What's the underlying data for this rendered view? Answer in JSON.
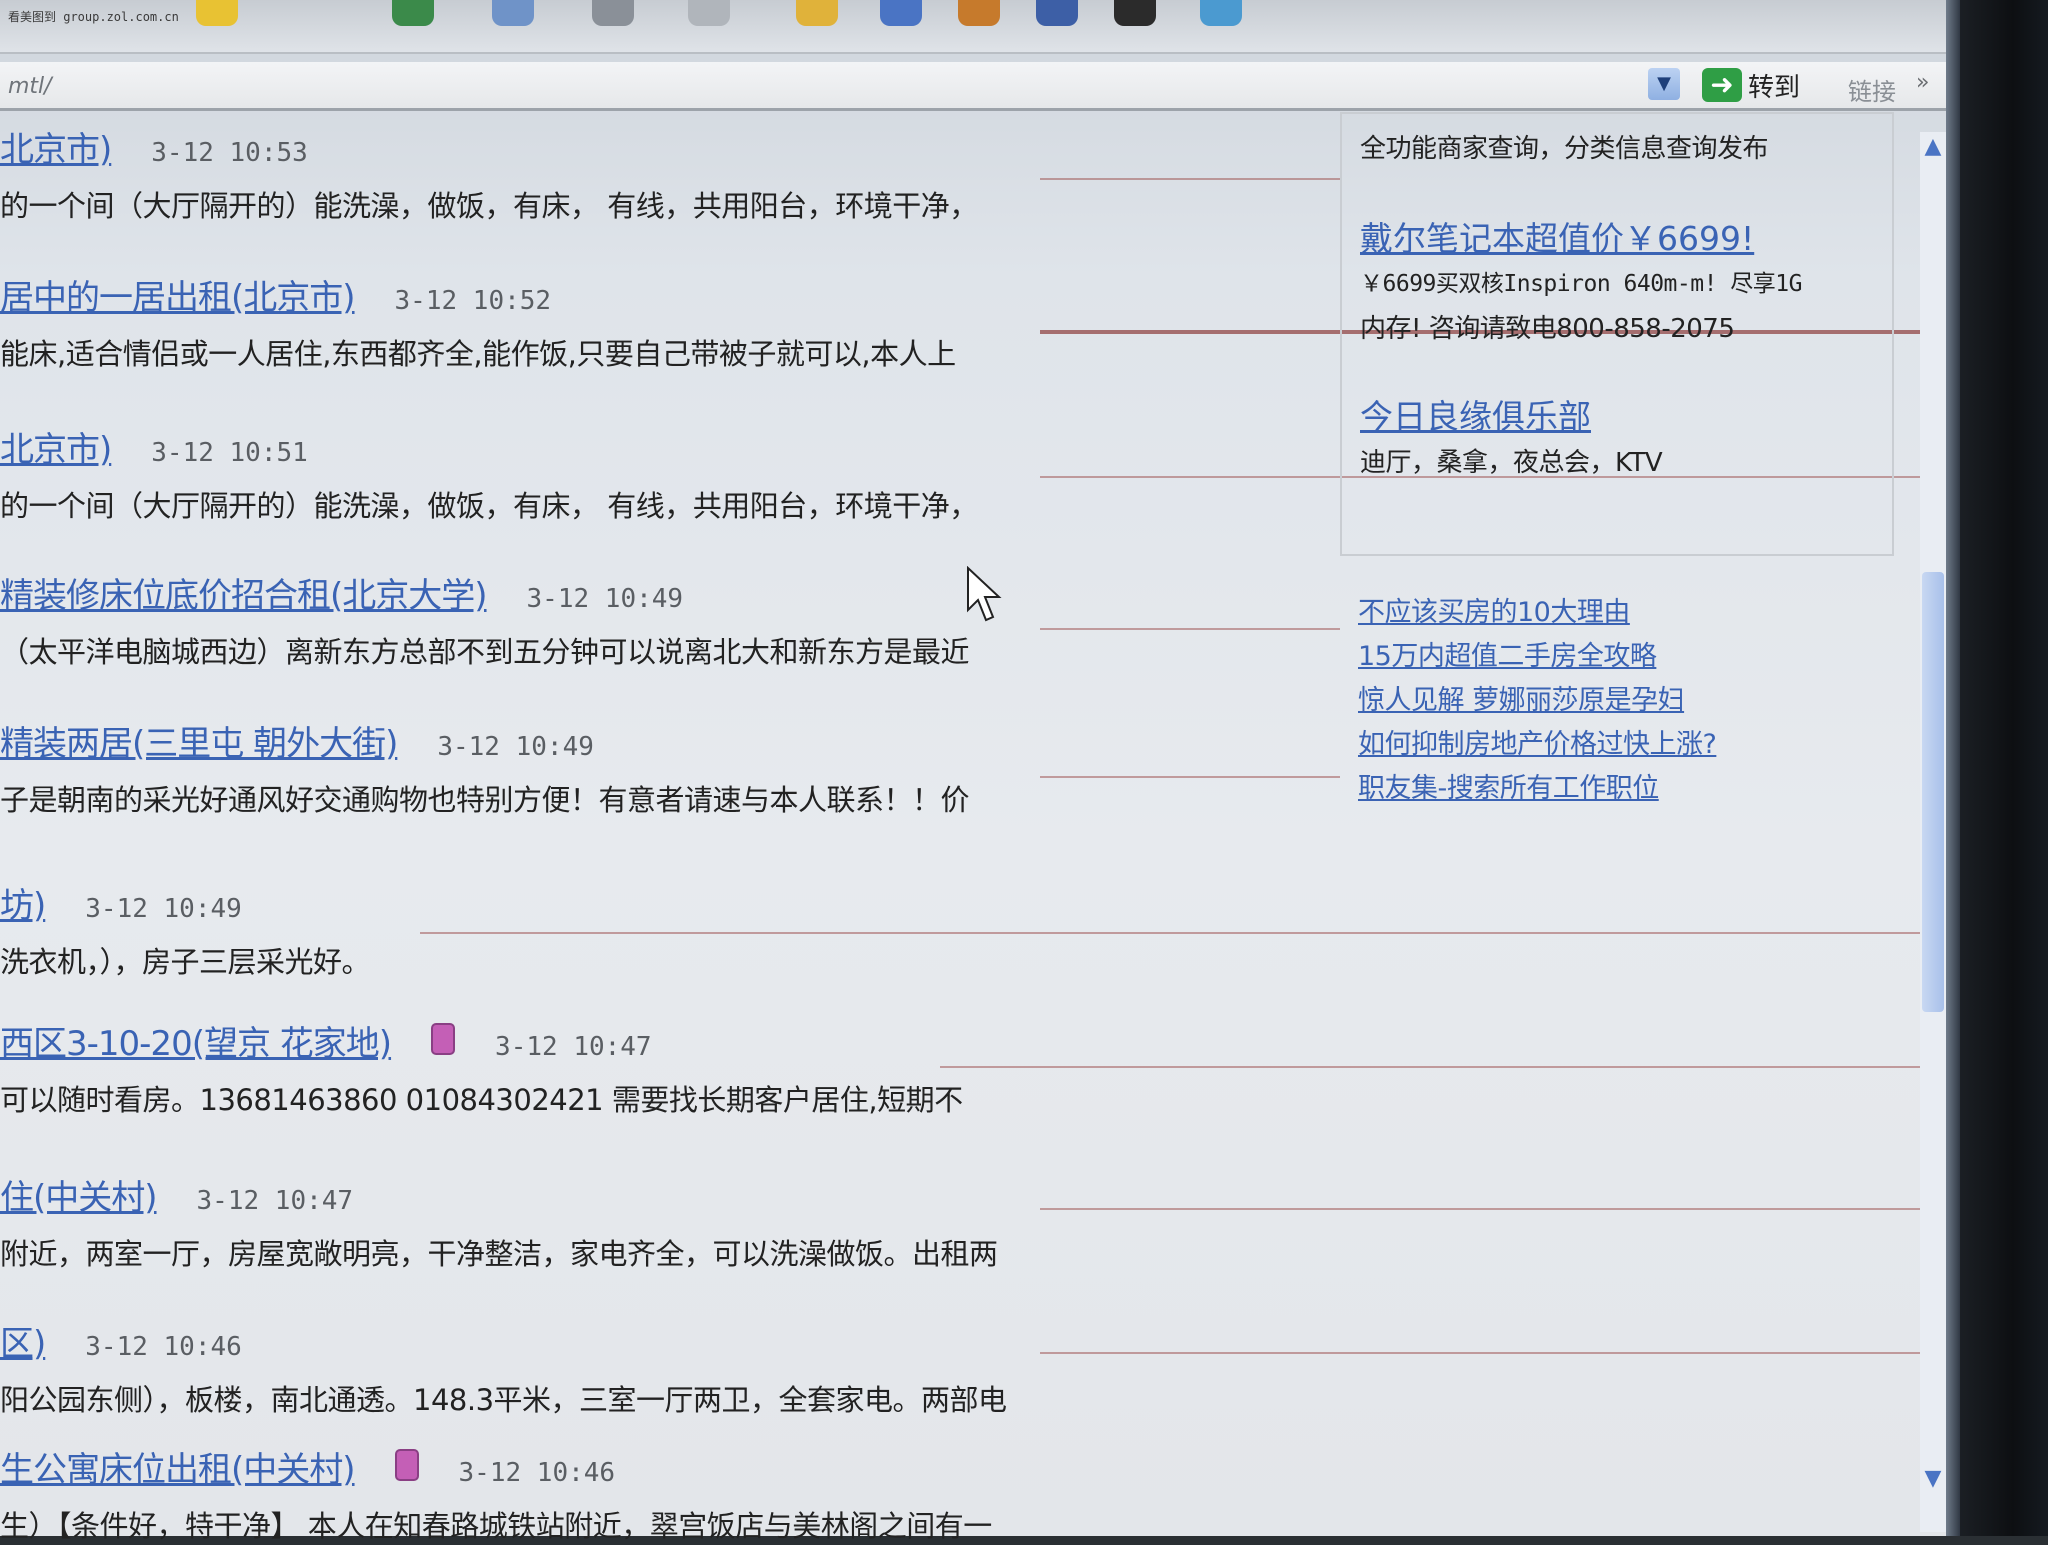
{
  "watermark": "看美图到 group.zol.com.cn",
  "address": {
    "text": "mtl/",
    "go_label": "转到",
    "links_label": "链接",
    "overflow": "»"
  },
  "listings": [
    {
      "title": "北京市)",
      "time": "3-12 10:53",
      "snippet": "的一个间（大厅隔开的）能洗澡，做饭，有床， 有线，共用阳台，环境干净，",
      "badge": false
    },
    {
      "title": "居中的一居出租(北京市)",
      "time": "3-12 10:52",
      "snippet": "能床,适合情侣或一人居住,东西都齐全,能作饭,只要自己带被子就可以,本人上",
      "badge": false
    },
    {
      "title": "北京市)",
      "time": "3-12 10:51",
      "snippet": "的一个间（大厅隔开的）能洗澡，做饭，有床， 有线，共用阳台，环境干净，",
      "badge": false
    },
    {
      "title": "精装修床位底价招合租(北京大学)",
      "time": "3-12 10:49",
      "snippet": "（太平洋电脑城西边）离新东方总部不到五分钟可以说离北大和新东方是最近",
      "badge": false
    },
    {
      "title": "精装两居(三里屯 朝外大街)",
      "time": "3-12 10:49",
      "snippet": "子是朝南的采光好通风好交通购物也特别方便！有意者请速与本人联系！！价",
      "badge": false
    },
    {
      "title": "坊)",
      "time": "3-12 10:49",
      "snippet": "洗衣机，），房子三层采光好。",
      "badge": false
    },
    {
      "title": "西区3-10-20(望京 花家地)",
      "time": "3-12 10:47",
      "snippet": "可以随时看房。13681463860 01084302421 需要找长期客户居住,短期不",
      "badge": true
    },
    {
      "title": "住(中关村)",
      "time": "3-12 10:47",
      "snippet": "附近，两室一厅，房屋宽敞明亮，干净整洁，家电齐全，可以洗澡做饭。出租两",
      "badge": false
    },
    {
      "title": "区)",
      "time": "3-12 10:46",
      "snippet": "阳公园东侧），板楼，南北通透。148.3平米，三室一厅两卫，全套家电。两部电",
      "badge": false
    },
    {
      "title": "生公寓床位出租(中关村)",
      "time": "3-12 10:46",
      "snippet": "生）【条件好，特干净】 本人在知春路城铁站附近，翠宫饭店与美林阁之间有一",
      "badge": true
    }
  ],
  "sidebar": {
    "top_text": "全功能商家查询，分类信息查询发布",
    "ad1": {
      "title": "戴尔笔记本超值价￥6699!",
      "line1": "￥6699买双核Inspiron 640m-m! 尽享1G",
      "line2": "内存! 咨询请致电800-858-2075"
    },
    "ad2": {
      "title": "今日良缘俱乐部",
      "line1": "迪厅，桑拿，夜总会，KTV"
    },
    "links": [
      "不应该买房的10大理由",
      "15万内超值二手房全攻略",
      "惊人见解 萝娜丽莎原是孕妇",
      "如何抑制房地产价格过快上涨?",
      "职友集-搜索所有工作职位"
    ]
  },
  "icons": {
    "toolbar": [
      "star-icon",
      "globe-icon",
      "mail-icon",
      "printer-icon",
      "edit-icon",
      "folder-icon",
      "bird-icon",
      "media-icon",
      "search-icon",
      "penguin-icon",
      "network-icon"
    ],
    "go": "right-arrow-icon",
    "dropdown": "chevron-down-icon",
    "cursor": "mouse-cursor-icon"
  },
  "colors": {
    "link": "#3a63b4",
    "go_green": "#2f9e45",
    "badge": "#c45fb6"
  }
}
